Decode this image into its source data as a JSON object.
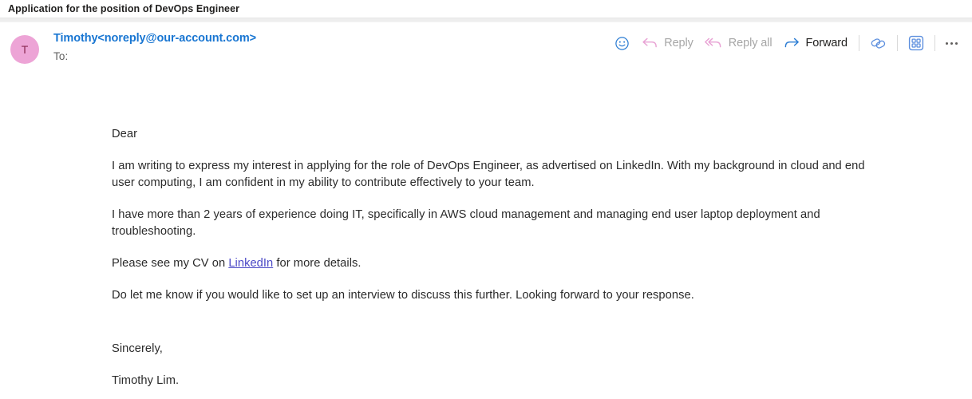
{
  "window": {
    "subject": "Application for the position of DevOps Engineer"
  },
  "header": {
    "avatar_initial": "T",
    "avatar_color": "#eda4d6",
    "sender": "Timothy<noreply@our-account.com>",
    "sender_color": "#1976d2",
    "to_label": "To:"
  },
  "toolbar": {
    "react_icon": "smiley-icon",
    "reply_label": "Reply",
    "reply_all_label": "Reply all",
    "forward_label": "Forward",
    "tag_icon": "overlapping-shapes-icon",
    "apps_icon": "grid-apps-icon",
    "more_label": "More actions",
    "disabled_color": "#a6a6a6",
    "accent_color": "#2b7cd3",
    "reply_arrow_color": "#e8a2d4"
  },
  "message": {
    "greeting": "Dear",
    "paragraph_1": "I am writing to express my interest in applying for the role of DevOps Engineer, as advertised on LinkedIn. With my background in cloud and end user computing, I am confident in my ability to contribute effectively to your team.",
    "paragraph_2": "I have more than 2 years of experience doing IT, specifically in AWS cloud management and managing end user laptop deployment and troubleshooting.",
    "paragraph_3_before_link": "Please see my CV on ",
    "paragraph_3_link": "LinkedIn",
    "paragraph_3_after_link": " for more details.",
    "paragraph_4": "Do let me know if you would like to set up an interview to discuss this further. Looking forward to your response.",
    "closing": "Sincerely,",
    "signature": "Timothy Lim.",
    "link_color": "#4b49c6"
  }
}
